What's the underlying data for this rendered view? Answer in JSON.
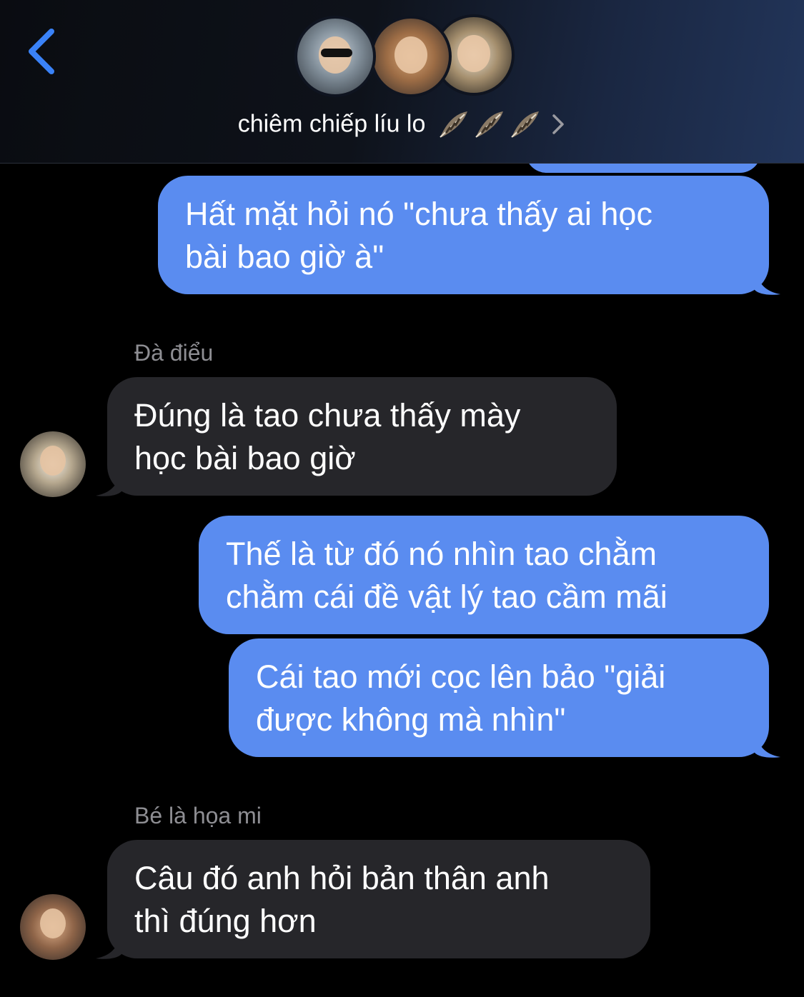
{
  "header": {
    "title": "chiêm chiếp líu lo",
    "back_icon": "chevron-left-icon",
    "title_emoji": "feather-icon ×3",
    "accent_color": "#3a82f7"
  },
  "colors": {
    "outgoing_bubble": "#5a8cf0",
    "incoming_bubble": "#26262a",
    "sender_name": "#8e8e93",
    "background": "#000000"
  },
  "messages": [
    {
      "direction": "out",
      "text": "Hất mặt hỏi nó \"chưa thấy ai học\nbài bao giờ à\""
    },
    {
      "direction": "in",
      "sender": "Đà điểu",
      "text": "Đúng là tao chưa thấy mày\nhọc bài bao giờ"
    },
    {
      "direction": "out",
      "text": "Thế là từ đó nó nhìn tao chằm\nchằm cái đề vật lý tao cầm mãi"
    },
    {
      "direction": "out",
      "text": "Cái tao mới cọc lên bảo \"giải\nđược không mà nhìn\""
    },
    {
      "direction": "in",
      "sender": "Bé là họa mi",
      "text": "Câu đó anh hỏi bản thân anh\nthì đúng hơn"
    }
  ]
}
